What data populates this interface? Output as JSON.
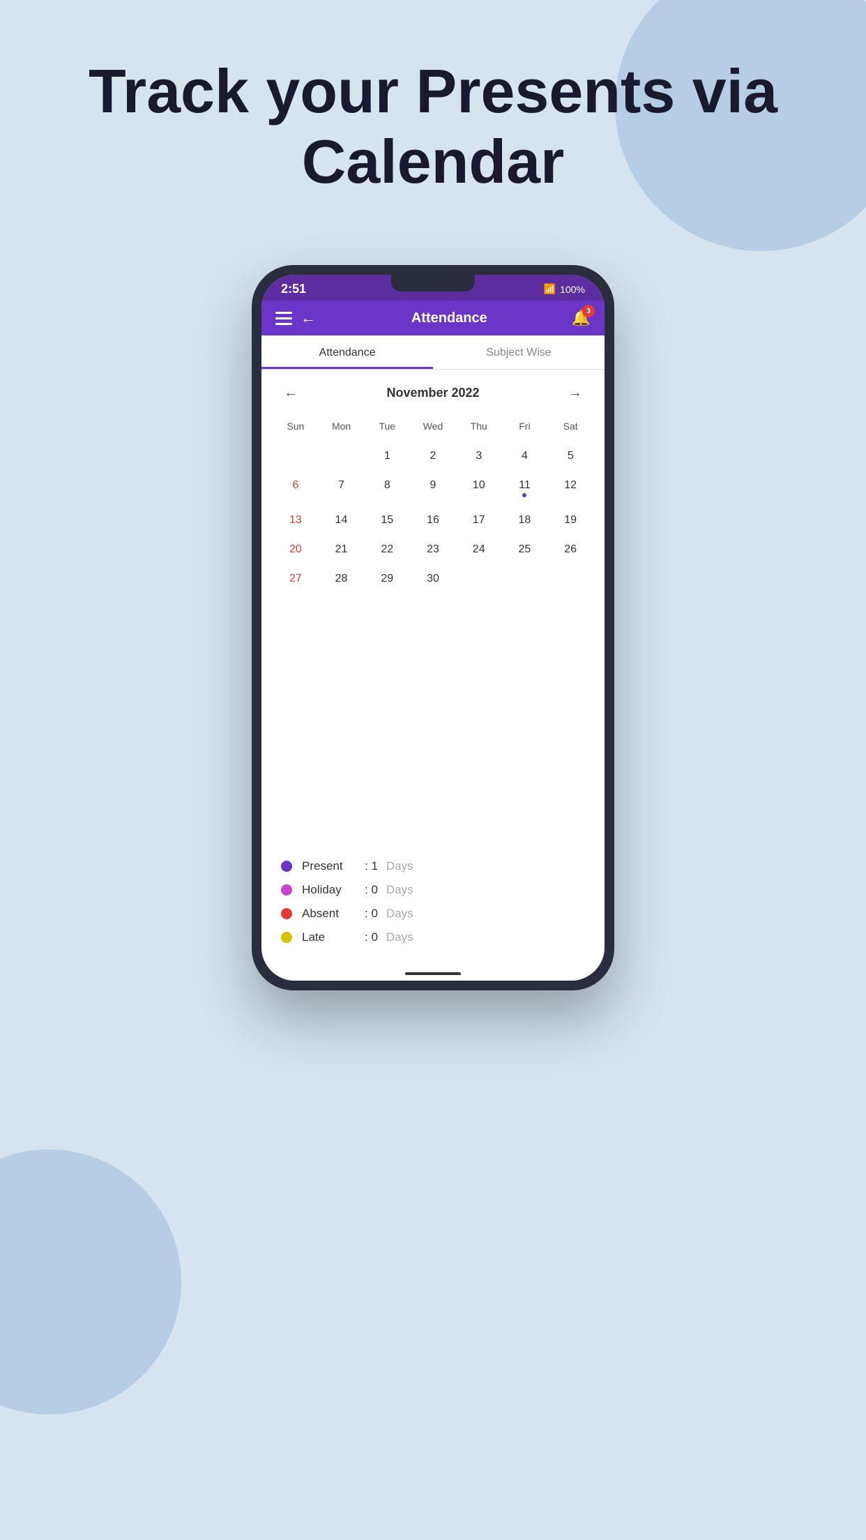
{
  "page": {
    "title_line1": "Track your Presents via",
    "title_line2": "Calendar"
  },
  "status_bar": {
    "time": "2:51",
    "battery": "100%"
  },
  "nav": {
    "title": "Attendance",
    "bell_badge": "3"
  },
  "tabs": [
    {
      "id": "attendance",
      "label": "Attendance",
      "active": true
    },
    {
      "id": "subject-wise",
      "label": "Subject Wise",
      "active": false
    }
  ],
  "calendar": {
    "month_title": "November 2022",
    "day_headers": [
      "Sun",
      "Mon",
      "Tue",
      "Wed",
      "Thu",
      "Fri",
      "Sat"
    ],
    "weeks": [
      [
        "",
        "",
        "1",
        "2",
        "3",
        "4",
        "5"
      ],
      [
        "6",
        "7",
        "8",
        "9",
        "10",
        "11",
        "12"
      ],
      [
        "13",
        "14",
        "15",
        "16",
        "17",
        "18",
        "19"
      ],
      [
        "20",
        "21",
        "22",
        "23",
        "24",
        "25",
        "26"
      ],
      [
        "27",
        "28",
        "29",
        "30",
        "",
        "",
        ""
      ]
    ],
    "sunday_dates": [
      "6",
      "13",
      "20",
      "27"
    ],
    "dot_date": "11"
  },
  "legend": [
    {
      "id": "present",
      "label": "Present",
      "color": "#6b35c8",
      "count": ": 1",
      "unit": "Days"
    },
    {
      "id": "holiday",
      "label": "Holiday",
      "color": "#cc44cc",
      "count": ": 0",
      "unit": "Days"
    },
    {
      "id": "absent",
      "label": "Absent",
      "color": "#e53935",
      "count": ": 0",
      "unit": "Days"
    },
    {
      "id": "late",
      "label": "Late",
      "color": "#d4c400",
      "count": ": 0",
      "unit": "Days"
    }
  ]
}
